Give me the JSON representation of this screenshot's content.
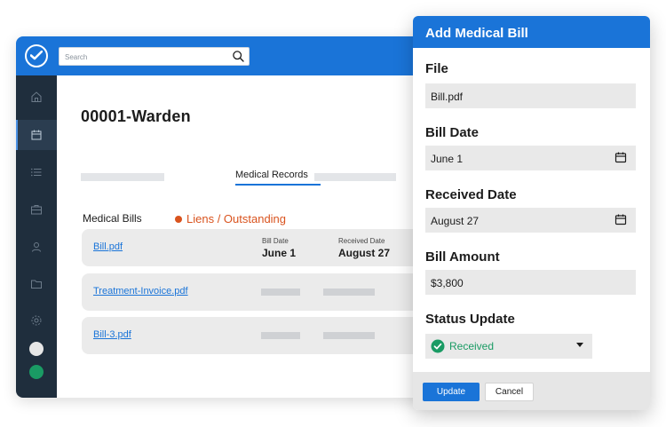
{
  "search": {
    "placeholder": "Search"
  },
  "case": {
    "title": "00001-Warden"
  },
  "tabs": {
    "active_label": "Medical Records"
  },
  "section": {
    "medical_bills_label": "Medical Bills",
    "liens_label": "Liens / Outstanding"
  },
  "bills": [
    {
      "file": "Bill.pdf",
      "bill_date_label": "Bill Date",
      "bill_date": "June 1",
      "received_date_label": "Received Date",
      "received_date": "August 27"
    },
    {
      "file": "Treatment-Invoice.pdf"
    },
    {
      "file": "Bill-3.pdf"
    }
  ],
  "sidebar": {
    "icons": [
      "home-icon",
      "calendar-icon",
      "list-icon",
      "briefcase-icon",
      "user-icon",
      "folder-icon",
      "settings-icon"
    ],
    "dots": [
      "#e6e6e6",
      "#1a9b64"
    ]
  },
  "modal": {
    "title": "Add Medical Bill",
    "file_label": "File",
    "file_value": "Bill.pdf",
    "bill_date_label": "Bill Date",
    "bill_date_value": "June 1",
    "received_date_label": "Received Date",
    "received_date_value": "August 27",
    "amount_label": "Bill Amount",
    "amount_value": "$3,800",
    "status_label": "Status Update",
    "status_value": "Received",
    "update_button": "Update",
    "cancel_button": "Cancel"
  },
  "colors": {
    "primary": "#1a74d8",
    "sidebar": "#1f2e3d",
    "success": "#1a9b64",
    "warning": "#d9531e"
  }
}
